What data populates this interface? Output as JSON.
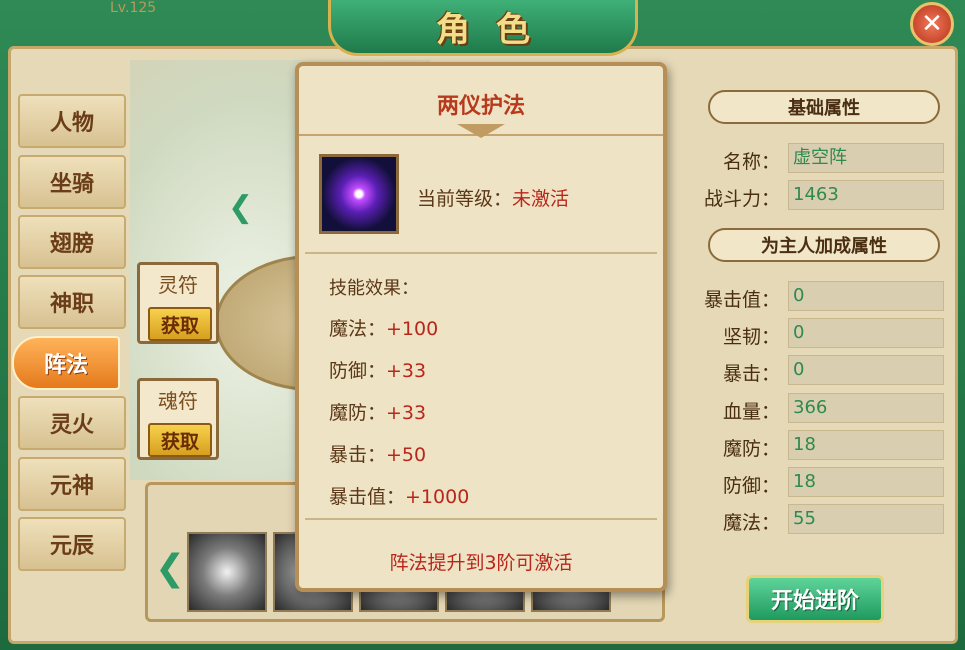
{
  "window": {
    "title": "角色",
    "level_tag": "Lv.125"
  },
  "tabs": [
    "人物",
    "坐骑",
    "翅膀",
    "神职",
    "阵法",
    "灵火",
    "元神",
    "元辰"
  ],
  "active_tab": "阵法",
  "talismans": [
    {
      "label": "灵符",
      "button": "获取"
    },
    {
      "label": "魂符",
      "button": "获取"
    }
  ],
  "popup": {
    "title": "两仪护法",
    "level_label": "当前等级：",
    "level_value": "未激活",
    "effects_heading": "技能效果：",
    "effects": [
      {
        "label": "魔法：",
        "value": "+100"
      },
      {
        "label": "防御：",
        "value": "+33"
      },
      {
        "label": "魔防：",
        "value": "+33"
      },
      {
        "label": "暴击：",
        "value": "+50"
      },
      {
        "label": "暴击值：",
        "value": "+1000"
      }
    ],
    "unlock_text": "阵法提升到3阶可激活"
  },
  "base_attrs": {
    "heading": "基础属性",
    "rows": [
      {
        "label": "名称：",
        "value": "虚空阵"
      },
      {
        "label": "战斗力：",
        "value": "1463"
      }
    ]
  },
  "bonus_attrs": {
    "heading": "为主人加成属性",
    "rows": [
      {
        "label": "暴击值：",
        "value": "0"
      },
      {
        "label": "坚韧：",
        "value": "0"
      },
      {
        "label": "暴击：",
        "value": "0"
      },
      {
        "label": "血量：",
        "value": "366"
      },
      {
        "label": "魔防：",
        "value": "18"
      },
      {
        "label": "防御：",
        "value": "18"
      },
      {
        "label": "魔法：",
        "value": "55"
      }
    ]
  },
  "advance_button": "开始进阶",
  "icons": {
    "close": "close-icon",
    "nav_left": "chevron-left-icon",
    "skill": "formation-orb-icon"
  },
  "colors": {
    "accent_green": "#2f8a55",
    "highlight_red": "#b8271c",
    "active_tab": "#e47a1c"
  }
}
